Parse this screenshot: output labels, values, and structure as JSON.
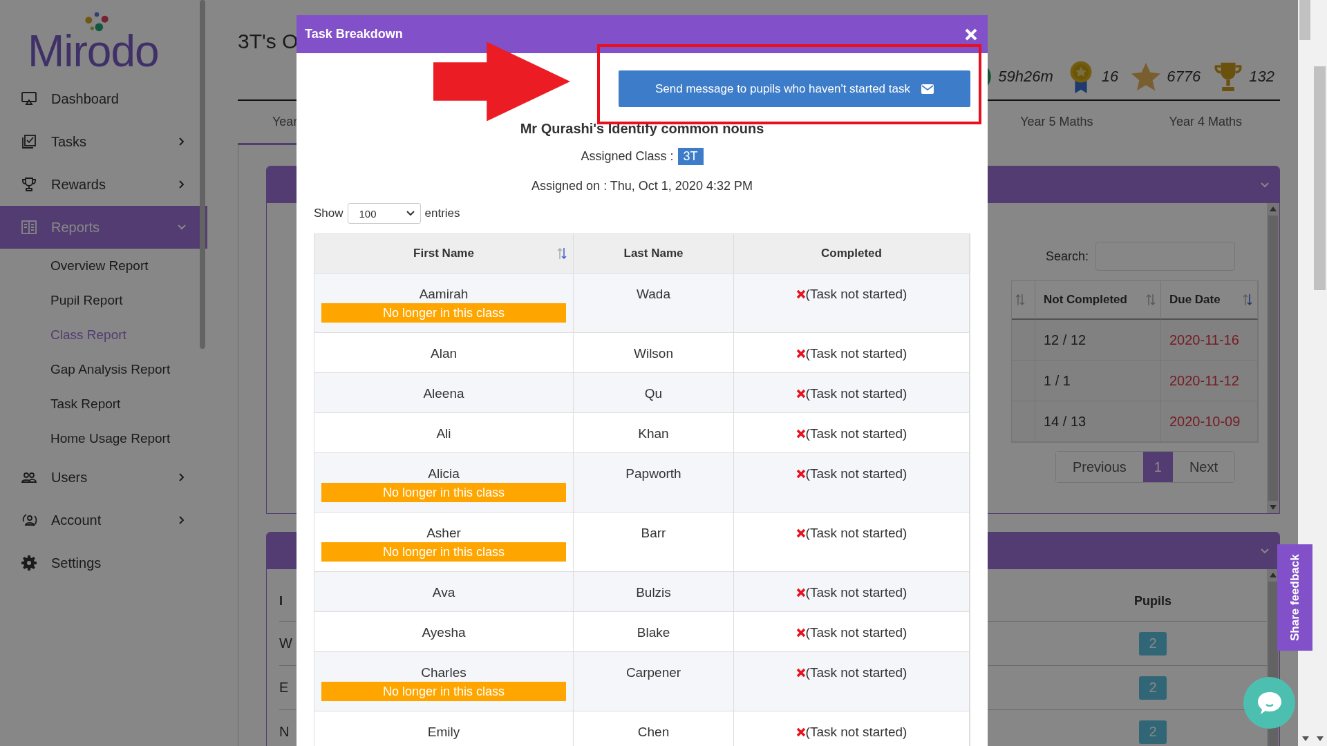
{
  "sidebar": {
    "logo": "Mirodo",
    "items": [
      {
        "kind": "dashboard",
        "label": "Dashboard",
        "selected": false
      },
      {
        "kind": "tasks",
        "label": "Tasks",
        "selected": false,
        "expanded": false
      },
      {
        "kind": "rewards",
        "label": "Rewards",
        "selected": false,
        "expanded": false
      },
      {
        "kind": "reports",
        "label": "Reports",
        "selected": true,
        "expanded": true,
        "children": [
          {
            "label": "Overview Report",
            "selected": false
          },
          {
            "label": "Pupil Report",
            "selected": false
          },
          {
            "label": "Class Report",
            "selected": true
          },
          {
            "label": "Gap Analysis Report",
            "selected": false
          },
          {
            "label": "Task Report",
            "selected": false
          },
          {
            "label": "Home Usage Report",
            "selected": false
          }
        ]
      },
      {
        "kind": "users",
        "label": "Users",
        "selected": false,
        "expanded": false
      },
      {
        "kind": "account",
        "label": "Account",
        "selected": false,
        "expanded": false
      },
      {
        "kind": "settings",
        "label": "Settings",
        "selected": false
      }
    ]
  },
  "page": {
    "title": "3T's O",
    "stats": [
      {
        "kind": "time",
        "value": "59h26m"
      },
      {
        "kind": "medal",
        "value": "16"
      },
      {
        "kind": "star",
        "value": "6776"
      },
      {
        "kind": "trophy",
        "value": "132"
      }
    ],
    "tabs": [
      {
        "label": "Year",
        "selected": true
      },
      {
        "label": "Year 5 Maths",
        "selected": false
      },
      {
        "label": "Year 4 Maths",
        "selected": false
      }
    ],
    "tasks_panel": {
      "search_label": "Search:",
      "columns": [
        "Not Completed",
        "Due Date"
      ],
      "rows": [
        {
          "not_completed": "12 / 12",
          "due_date": "2020-11-16"
        },
        {
          "not_completed": "1 / 1",
          "due_date": "2020-11-12"
        },
        {
          "not_completed": "14 / 13",
          "due_date": "2020-10-09"
        }
      ],
      "pagination": {
        "previous": "Previous",
        "pages": [
          {
            "label": "1",
            "selected": true
          }
        ],
        "next": "Next"
      }
    },
    "classes_panel": {
      "columns": [
        "I",
        "Pupils"
      ],
      "rows": [
        {
          "column_1": "W",
          "pupils": "2"
        },
        {
          "column_1": "E",
          "pupils": "2"
        },
        {
          "column_1": "N",
          "pupils": "2"
        }
      ]
    }
  },
  "modal": {
    "title": "Task Breakdown",
    "send_button": "Send message to pupils who haven't started task",
    "task_title": "Mr Qurashi's Identify common nouns",
    "assigned_class_label": "Assigned Class :",
    "assigned_class": "3T",
    "assigned_on": "Assigned on : Thu, Oct 1, 2020 4:32 PM",
    "show_label": "Show",
    "page_size": "100",
    "entries_label": "entries",
    "columns": [
      "First Name",
      "Last Name",
      "Completed"
    ],
    "rows": [
      {
        "first_name": "Aamirah",
        "badge": "No longer in this class",
        "last_name": "Wada",
        "completed": false,
        "status": "(Task not started)"
      },
      {
        "first_name": "Alan",
        "last_name": "Wilson",
        "completed": false,
        "status": "(Task not started)"
      },
      {
        "first_name": "Aleena",
        "last_name": "Qu",
        "completed": false,
        "status": "(Task not started)"
      },
      {
        "first_name": "Ali",
        "last_name": "Khan",
        "completed": false,
        "status": "(Task not started)"
      },
      {
        "first_name": "Alicia",
        "badge": "No longer in this class",
        "last_name": "Papworth",
        "completed": false,
        "status": "(Task not started)"
      },
      {
        "first_name": "Asher",
        "badge": "No longer in this class",
        "last_name": "Barr",
        "completed": false,
        "status": "(Task not started)"
      },
      {
        "first_name": "Ava",
        "last_name": "Bulzis",
        "completed": false,
        "status": "(Task not started)"
      },
      {
        "first_name": "Ayesha",
        "last_name": "Blake",
        "completed": false,
        "status": "(Task not started)"
      },
      {
        "first_name": "Charles",
        "badge": "No longer in this class",
        "last_name": "Carpener",
        "completed": false,
        "status": "(Task not started)"
      },
      {
        "first_name": "Emily",
        "last_name": "Chen",
        "completed": false,
        "status": "(Task not started)"
      }
    ]
  },
  "feedback_tab": "Share feedback"
}
